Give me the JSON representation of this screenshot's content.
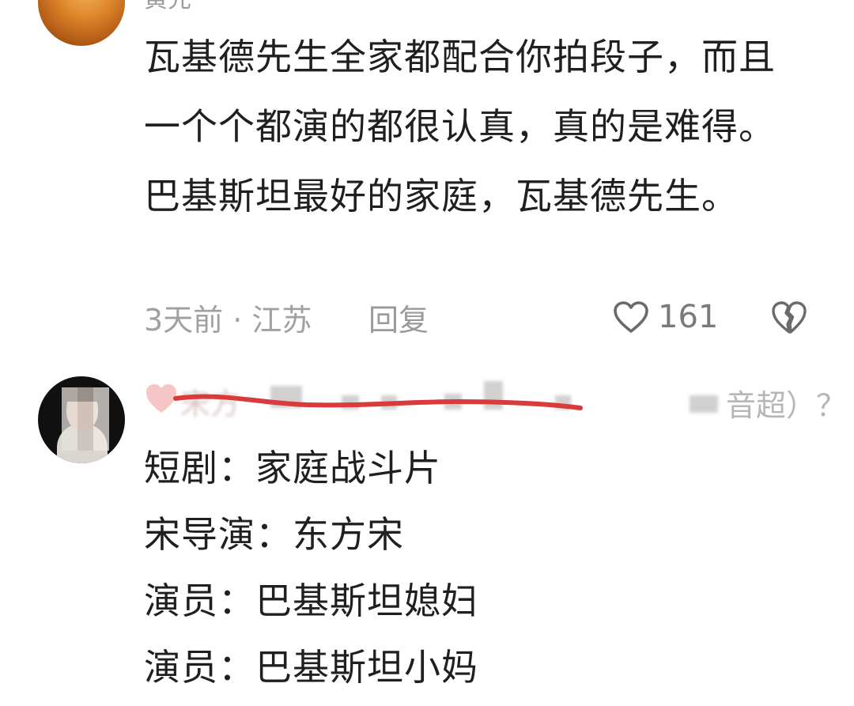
{
  "comment_1": {
    "author_name_cropped": "黄先",
    "text": "瓦基德先生全家都配合你拍段子，而且一个个都演的都很认真，真的是难得。巴基斯坦最好的家庭，瓦基德先生。",
    "time_location": "3天前 · 江苏",
    "reply_label": "回复",
    "like_count": "161",
    "icons": {
      "avatar": "avatar-image",
      "like": "heart-outline-icon",
      "dislike": "broken-heart-icon"
    }
  },
  "comment_2": {
    "author_blurred": "宋方",
    "author_tail": "音超）？",
    "reply_lines": [
      "短剧：家庭战斗片",
      "宋导演：东方宋",
      "演员：巴基斯坦媳妇",
      "演员：巴基斯坦小妈"
    ],
    "icons": {
      "avatar": "avatar-image",
      "badge": "pink-heart-icon"
    }
  },
  "colors": {
    "text": "#1f1f1f",
    "meta": "#a0a0a0",
    "annotation_line": "#d93a3a"
  }
}
